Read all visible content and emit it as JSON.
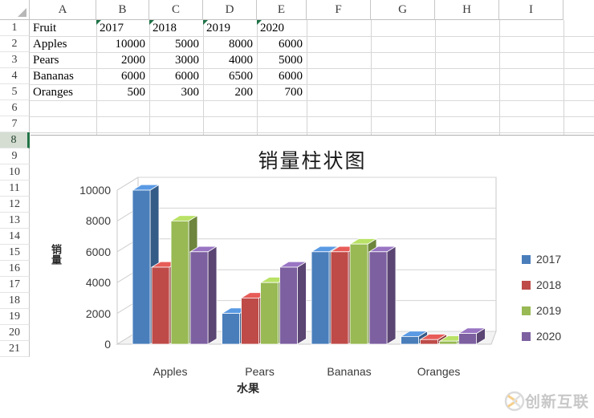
{
  "sheet": {
    "column_headers": [
      "A",
      "B",
      "C",
      "D",
      "E",
      "F",
      "G",
      "H",
      "I"
    ],
    "row_headers": [
      "1",
      "2",
      "3",
      "4",
      "5",
      "6",
      "7",
      "8",
      "9",
      "10",
      "11",
      "12",
      "13",
      "14",
      "15",
      "16",
      "17",
      "18",
      "19",
      "20",
      "21"
    ],
    "active_row": "8",
    "rows": [
      {
        "cells": [
          {
            "col": "A",
            "value": "Fruit",
            "align": "left",
            "error_flag": false
          },
          {
            "col": "B",
            "value": "2017",
            "align": "left",
            "error_flag": true
          },
          {
            "col": "C",
            "value": "2018",
            "align": "left",
            "error_flag": true
          },
          {
            "col": "D",
            "value": "2019",
            "align": "left",
            "error_flag": true
          },
          {
            "col": "E",
            "value": "2020",
            "align": "left",
            "error_flag": true
          }
        ]
      },
      {
        "cells": [
          {
            "col": "A",
            "value": "Apples",
            "align": "left",
            "error_flag": false
          },
          {
            "col": "B",
            "value": "10000",
            "align": "right",
            "error_flag": false
          },
          {
            "col": "C",
            "value": "5000",
            "align": "right",
            "error_flag": false
          },
          {
            "col": "D",
            "value": "8000",
            "align": "right",
            "error_flag": false
          },
          {
            "col": "E",
            "value": "6000",
            "align": "right",
            "error_flag": false
          }
        ]
      },
      {
        "cells": [
          {
            "col": "A",
            "value": "Pears",
            "align": "left",
            "error_flag": false
          },
          {
            "col": "B",
            "value": "2000",
            "align": "right",
            "error_flag": false
          },
          {
            "col": "C",
            "value": "3000",
            "align": "right",
            "error_flag": false
          },
          {
            "col": "D",
            "value": "4000",
            "align": "right",
            "error_flag": false
          },
          {
            "col": "E",
            "value": "5000",
            "align": "right",
            "error_flag": false
          }
        ]
      },
      {
        "cells": [
          {
            "col": "A",
            "value": "Bananas",
            "align": "left",
            "error_flag": false
          },
          {
            "col": "B",
            "value": "6000",
            "align": "right",
            "error_flag": false
          },
          {
            "col": "C",
            "value": "6000",
            "align": "right",
            "error_flag": false
          },
          {
            "col": "D",
            "value": "6500",
            "align": "right",
            "error_flag": false
          },
          {
            "col": "E",
            "value": "6000",
            "align": "right",
            "error_flag": false
          }
        ]
      },
      {
        "cells": [
          {
            "col": "A",
            "value": "Oranges",
            "align": "left",
            "error_flag": false
          },
          {
            "col": "B",
            "value": "500",
            "align": "right",
            "error_flag": false
          },
          {
            "col": "C",
            "value": "300",
            "align": "right",
            "error_flag": false
          },
          {
            "col": "D",
            "value": "200",
            "align": "right",
            "error_flag": false
          },
          {
            "col": "E",
            "value": "700",
            "align": "right",
            "error_flag": false
          }
        ]
      }
    ]
  },
  "chart_data": {
    "type": "bar",
    "title": "销量柱状图",
    "xlabel": "水果",
    "ylabel": "销量",
    "categories": [
      "Apples",
      "Pears",
      "Bananas",
      "Oranges"
    ],
    "series": [
      {
        "name": "2017",
        "color": "#4A7EBB",
        "values": [
          10000,
          2000,
          6000,
          500
        ]
      },
      {
        "name": "2018",
        "color": "#BE4B48",
        "values": [
          5000,
          3000,
          6000,
          300
        ]
      },
      {
        "name": "2019",
        "color": "#98B954",
        "values": [
          8000,
          4000,
          6500,
          200
        ]
      },
      {
        "name": "2020",
        "color": "#7D60A0",
        "values": [
          6000,
          5000,
          6000,
          700
        ]
      }
    ],
    "ylim": [
      0,
      10000
    ],
    "yticks": [
      0,
      2000,
      4000,
      6000,
      8000,
      10000
    ],
    "ytick_labels": [
      "0",
      "2000",
      "4000",
      "6000",
      "8000",
      "10000"
    ],
    "grid": true,
    "legend_position": "right",
    "three_d": true
  },
  "watermark": {
    "text": "创新互联"
  }
}
